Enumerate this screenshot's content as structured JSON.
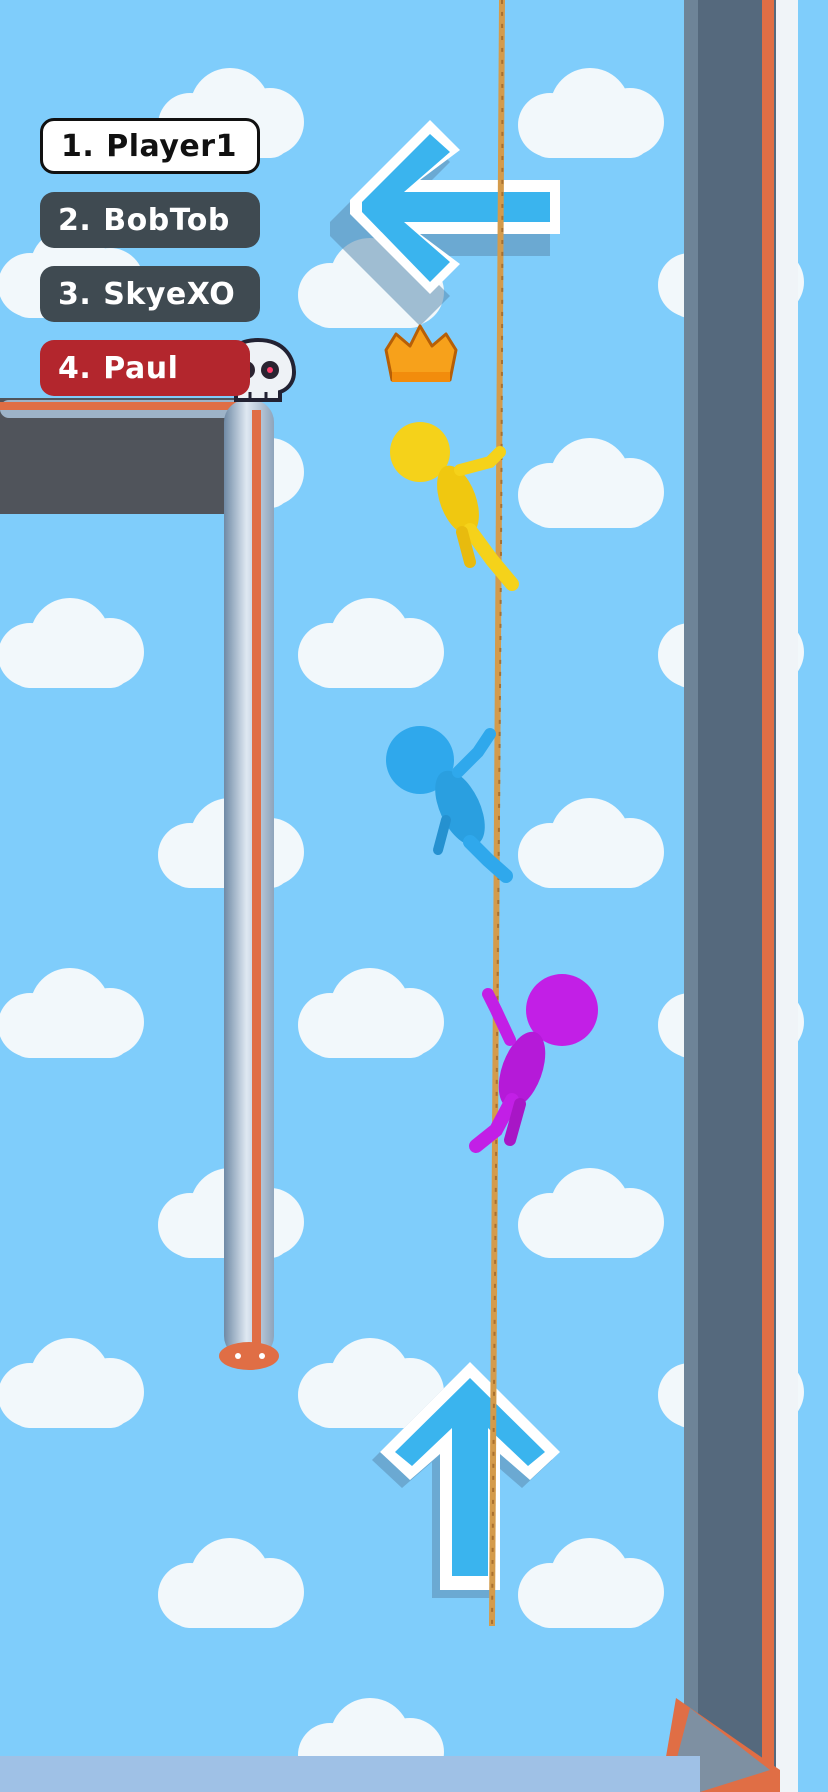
{
  "leaderboard": [
    {
      "rank": "1.",
      "name": "Player1",
      "status": "self"
    },
    {
      "rank": "2.",
      "name": "BobTob",
      "status": "active"
    },
    {
      "rank": "3.",
      "name": "SkyeXO",
      "status": "active"
    },
    {
      "rank": "4.",
      "name": "Paul",
      "status": "eliminated",
      "status_icon": "skull-icon"
    }
  ],
  "leader_icon": "crown-icon",
  "direction_hints": [
    "arrow-left-icon",
    "arrow-up-icon"
  ],
  "characters": [
    {
      "color": "#f5d21a",
      "place": "leader"
    },
    {
      "color": "#2fa8ec",
      "place": "second"
    },
    {
      "color": "#c21fe6",
      "place": "third"
    }
  ],
  "colors": {
    "sky": "#7fcdfb",
    "pillar": "#55697d",
    "pipe_trim": "#e06e45",
    "rope": "#d49b4b",
    "self_pill": "#ffffff",
    "other_pill": "#3f4a51",
    "eliminated_pill": "#b3262d"
  }
}
